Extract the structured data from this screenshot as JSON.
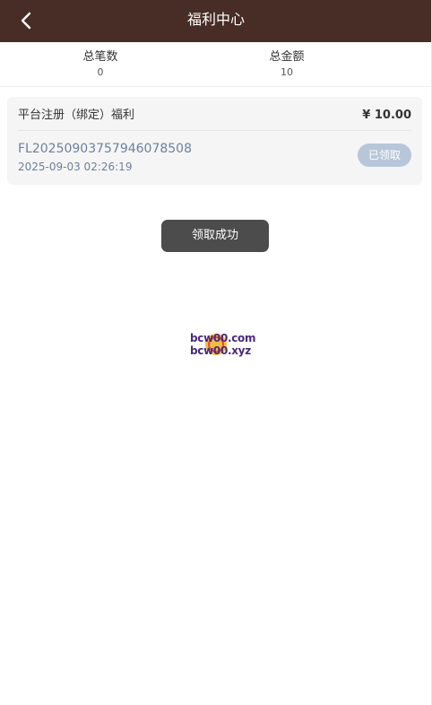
{
  "header": {
    "title": "福利中心",
    "back_icon": "chevron-left-icon",
    "background_color": "#472d26"
  },
  "summary": {
    "total_count_label": "总笔数",
    "total_count_value": "0",
    "total_amount_label": "总金额",
    "total_amount_value": "10"
  },
  "records": [
    {
      "title": "平台注册（绑定）福利",
      "amount": "¥ 10.00",
      "order_no": "FL20250903757946078508",
      "time": "2025-09-03 02:26:19",
      "status": "已领取",
      "status_color": "#b8c6d9"
    }
  ],
  "toast": {
    "message": "领取成功"
  },
  "watermark": {
    "line1": "bcw00.com",
    "line2": "bcw00.xyz"
  }
}
